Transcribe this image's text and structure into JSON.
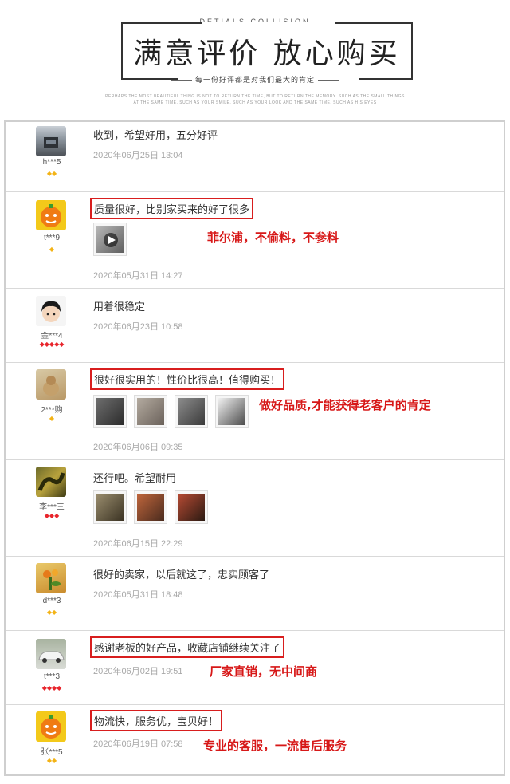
{
  "header": {
    "eyebrow": "DETIALS COLLISION",
    "title": "满意评价 放心购买",
    "subtitle": "每一份好评都是对我们最大的肯定",
    "fine_line_1": "PERHAPS THE MOST BEAUTIFUL THING IS NOT TO RETURN THE TIME, BUT TO RETURN THE MEMORY. SUCH AS THE SMALL THINGS",
    "fine_line_2": "AT THE SAME TIME, SUCH AS YOUR SMILE, SUCH AS YOUR LOOK AND THE SAME TIME, SUCH AS HIS EYES"
  },
  "reviews": [
    {
      "user": "h***5",
      "badge_type": "gold",
      "badge_count": 2,
      "text": "收到，希望好用，五分好评",
      "boxed": false,
      "date": "2020年06月25日 13:04",
      "note": "",
      "thumbs": 0
    },
    {
      "user": "t***9",
      "badge_type": "gold",
      "badge_count": 1,
      "text": "质量很好，比别家买来的好了很多",
      "boxed": true,
      "date": "2020年05月31日 14:27",
      "note": "菲尔浦，不偷料，不参料",
      "thumbs": 1
    },
    {
      "user": "金***4",
      "badge_type": "red",
      "badge_count": 5,
      "text": "用着很稳定",
      "boxed": false,
      "date": "2020年06月23日 10:58",
      "note": "",
      "thumbs": 0
    },
    {
      "user": "2***购",
      "badge_type": "gold",
      "badge_count": 1,
      "text": "很好很实用的！性价比很高！值得购买！",
      "boxed": true,
      "date": "2020年06月06日 09:35",
      "note": "做好品质,才能获得老客户的肯定",
      "thumbs": 4
    },
    {
      "user": "李***三",
      "badge_type": "red",
      "badge_count": 3,
      "text": "还行吧。希望耐用",
      "boxed": false,
      "date": "2020年06月15日 22:29",
      "note": "",
      "thumbs": 3
    },
    {
      "user": "d***3",
      "badge_type": "gold",
      "badge_count": 2,
      "text": "很好的卖家，以后就这了，忠实顾客了",
      "boxed": false,
      "date": "2020年05月31日 18:48",
      "note": "",
      "thumbs": 0
    },
    {
      "user": "t***3",
      "badge_type": "red",
      "badge_count": 4,
      "text": "感谢老板的好产品，收藏店铺继续关注了",
      "boxed": true,
      "date": "2020年06月02日 19:51",
      "note": "厂家直销，无中间商",
      "thumbs": 0
    },
    {
      "user": "张***5",
      "badge_type": "gold",
      "badge_count": 2,
      "text": "物流快，服务优，宝贝好！",
      "boxed": true,
      "date": "2020年06月19日 07:58",
      "note": "专业的客服，一流售后服务",
      "thumbs": 0
    }
  ],
  "colors": {
    "accent_red": "#d71818",
    "badge_gold": "#f3b316",
    "badge_red": "#e8262d",
    "date_gray": "#a8a8a8"
  }
}
